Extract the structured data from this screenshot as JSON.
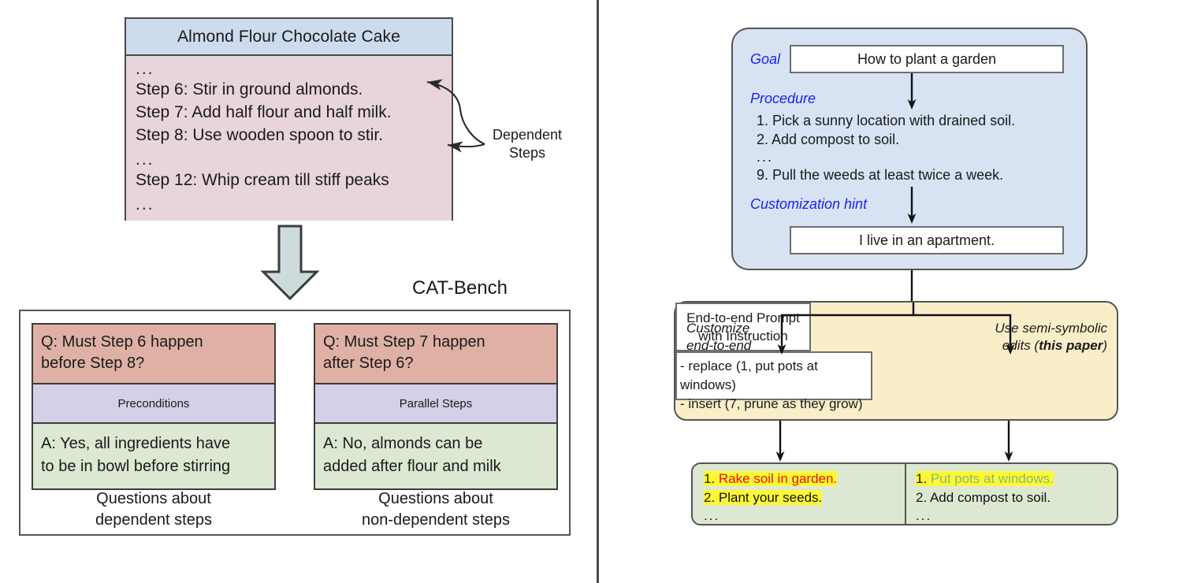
{
  "left_panel": {
    "recipe": {
      "title": "Almond Flour Chocolate Cake",
      "ellipsis": "...",
      "steps": [
        "Step 6: Stir in ground almonds.",
        "Step 7: Add half flour and half milk.",
        "Step 8: Use wooden spoon to stir.",
        "Step 12: Whip cream till stiff peaks"
      ],
      "colors": {
        "title_bg": "#ccdcee",
        "body_bg": "#e8d5db",
        "border": "#4a4a4a"
      }
    },
    "annotation": {
      "label_line1": "Dependent",
      "label_line2": "Steps"
    },
    "catbench": {
      "title": "CAT-Bench",
      "cards": [
        {
          "question": "Q: Must Step 6 happen before Step 8?",
          "question_line1": "Q: Must Step 6 happen",
          "question_line2": "before Step 8?",
          "type": "Preconditions",
          "answer_line1": "A: Yes, all ingredients have",
          "answer_line2": "to be in bowl before stirring",
          "caption_line1": "Questions about",
          "caption_line2": "dependent steps"
        },
        {
          "question": "Q: Must Step 7 happen after Step 6?",
          "question_line1": "Q: Must Step 7 happen",
          "question_line2": "after Step 6?",
          "type": "Parallel Steps",
          "answer_line1": "A: No, almonds can be",
          "answer_line2": "added after flour and milk",
          "caption_line1": "Questions about",
          "caption_line2": "non-dependent steps"
        }
      ],
      "colors": {
        "question_bg": "#dfb1a4",
        "type_bg": "#d6cfe8",
        "answer_bg": "#dce8d2"
      }
    }
  },
  "right_panel": {
    "input_block": {
      "goal_label": "Goal",
      "goal_text": "How to plant a garden",
      "procedure_label": "Procedure",
      "procedure_steps": [
        "1. Pick a sunny location with drained soil.",
        "2. Add compost to soil.",
        "9. Pull the weeds at least twice a week."
      ],
      "ellipsis": "...",
      "hint_label": "Customization hint",
      "hint_text": "I live in an apartment.",
      "bg_color": "#d7e3f2",
      "label_color": "#2020f0"
    },
    "methods_block": {
      "left_label_line1": "Customize",
      "left_label_line2": "end-to-end",
      "right_label_line1": "Use semi-symbolic",
      "right_label_line2_prefix": "edits (",
      "right_label_line2_bold": "this paper",
      "right_label_line2_suffix": ")",
      "left_box_line1": "End-to-end Prompt",
      "left_box_line2": "with Instruction",
      "right_box_line1": "- replace (1, put pots at windows)",
      "right_box_line2": "- insert (7, prune as they grow)",
      "bg_color": "#faeec9"
    },
    "outputs_block": {
      "bg_color": "#dde8d2",
      "highlight_color": "#fdf833",
      "left": {
        "line1_num": "1. ",
        "line1_text": "Rake soil in garden.",
        "line1_color": "#ee1111",
        "line2_num": "2. ",
        "line2_text": "Plant your seeds.",
        "line2_color": "#111111",
        "ellipsis": "..."
      },
      "right": {
        "line1_num": "1. ",
        "line1_text": "Put pots at windows.",
        "line1_color": "#8ab87a",
        "line2_num": "2. ",
        "line2_text": "Add compost to soil.",
        "line2_color": "#111111",
        "ellipsis": "..."
      }
    }
  }
}
